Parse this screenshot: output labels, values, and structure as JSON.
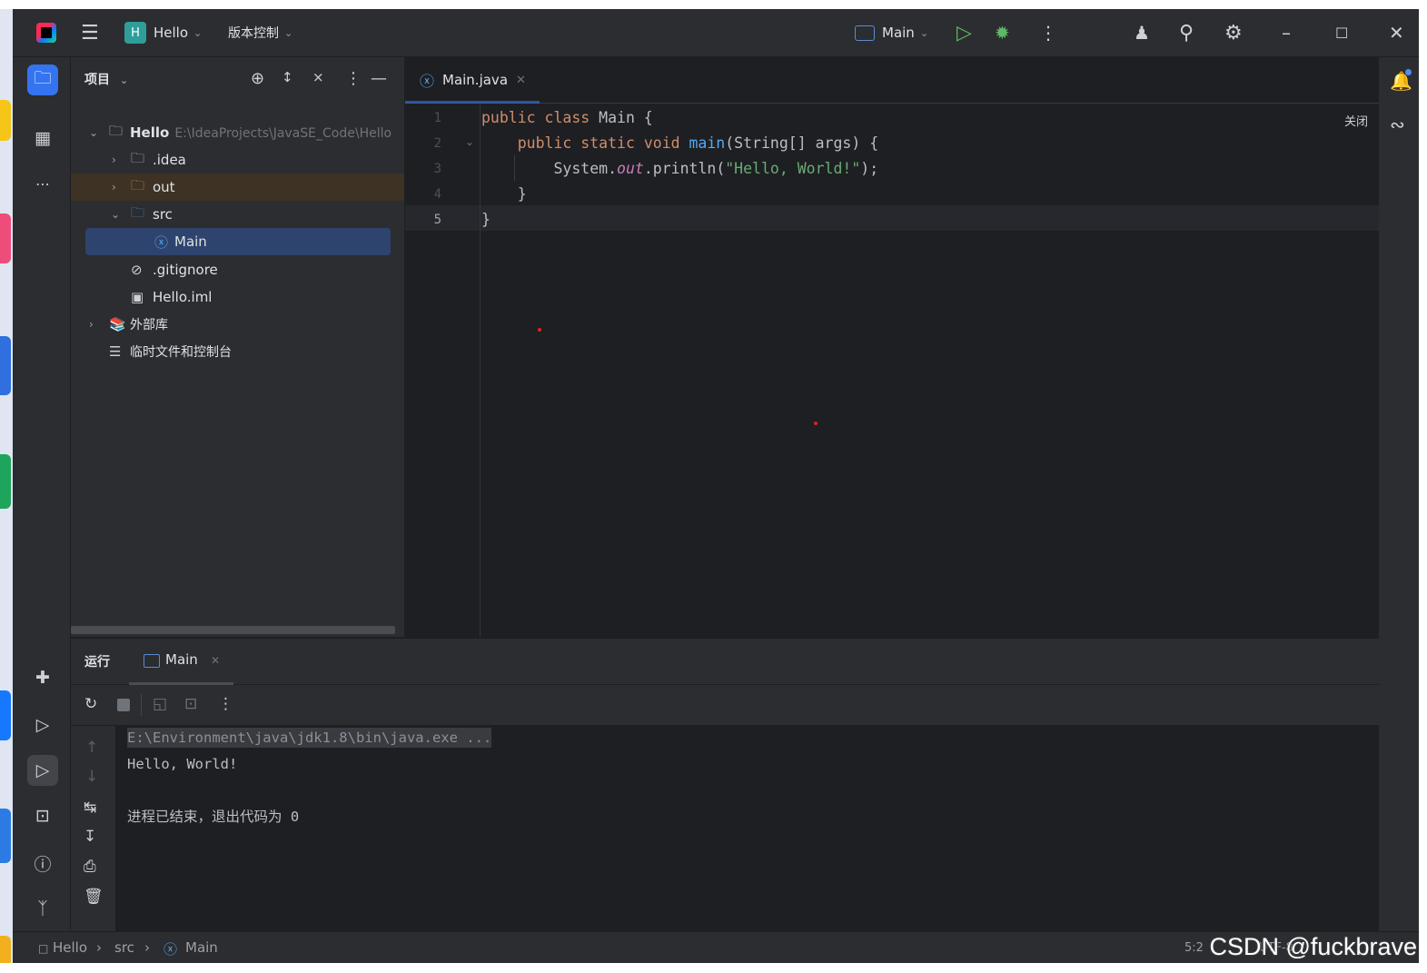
{
  "title_bar": {
    "project_badge": "H",
    "project_name": "Hello",
    "vcs_label": "版本控制",
    "run_config": "Main"
  },
  "project_panel": {
    "title": "项目",
    "tree": [
      {
        "label": "Hello",
        "path": "E:\\IdeaProjects\\JavaSE_Code\\Hello"
      },
      {
        "label": ".idea"
      },
      {
        "label": "out"
      },
      {
        "label": "src"
      },
      {
        "label": "Main"
      },
      {
        "label": ".gitignore"
      },
      {
        "label": "Hello.iml"
      },
      {
        "label": "外部库"
      },
      {
        "label": "临时文件和控制台"
      }
    ]
  },
  "editor": {
    "tab_label": "Main.java",
    "reader_mode": "关闭",
    "line_numbers": [
      "1",
      "2",
      "3",
      "4",
      "5"
    ],
    "code": {
      "l1_kw": "public class ",
      "l1_rest": "Main {",
      "l2_kw": "public static void ",
      "l2_fn": "main",
      "l2_rest": "(String[] args) {",
      "l3_a": "System.",
      "l3_b": "out",
      "l3_c": ".println(",
      "l3_str": "\"Hello, World!\"",
      "l3_d": ");",
      "l4": "}",
      "l5": "}"
    }
  },
  "run_panel": {
    "title": "运行",
    "tab_label": "Main",
    "console": {
      "cmd": "E:\\Environment\\java\\jdk1.8\\bin\\java.exe ...",
      "output": "Hello, World!",
      "exit": "进程已结束，退出代码为 0"
    }
  },
  "status_bar": {
    "crumbs": [
      "Hello",
      "src",
      "Main"
    ],
    "position": "5:2",
    "encoding": "UTF-8"
  },
  "watermark": "CSDN @fuckbrave",
  "colors": {
    "accent": "#3574f0",
    "background": "#1e1f22",
    "panel": "#2b2d30",
    "keyword": "#cf8e6d",
    "string": "#6aab73",
    "function": "#56a8f5"
  }
}
